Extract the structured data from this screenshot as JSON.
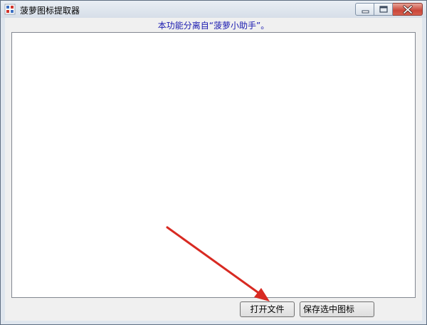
{
  "window": {
    "title": "菠萝图标提取器",
    "icon": "pineapple-app-icon",
    "controls": {
      "minimize_icon": "minimize-icon",
      "maximize_icon": "maximize-icon",
      "close_icon": "close-icon"
    }
  },
  "main": {
    "notice": "本功能分离自“菠萝小助手”。",
    "file_list": {
      "items": []
    }
  },
  "footer": {
    "open_file_label": "打开文件",
    "save_selected_label": "保存选中图标"
  },
  "annotation": {
    "arrow_color": "#d82a22"
  },
  "colors": {
    "notice_text": "#1a1ab0",
    "close_button": "#c9473a"
  }
}
